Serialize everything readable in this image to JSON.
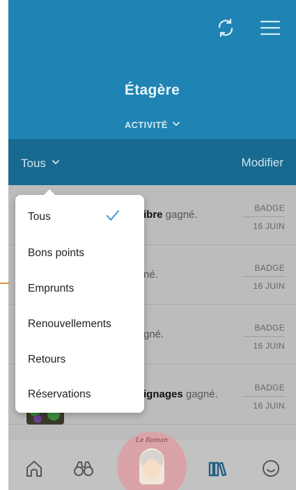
{
  "header": {
    "title": "Étagère",
    "subtitle": "ACTIVITÉ",
    "refresh_icon": "refresh-icon",
    "menu_icon": "hamburger-menu-icon"
  },
  "filterbar": {
    "selected": "Tous",
    "edit_label": "Modifier"
  },
  "dropdown": {
    "items": [
      "Tous",
      "Bons points",
      "Emprunts",
      "Renouvellements",
      "Retours",
      "Réservations"
    ],
    "selected_index": 0
  },
  "activity": [
    {
      "bold": "ibre",
      "rest": " gagné.",
      "badge": "BADGE",
      "date": "16 JUIN"
    },
    {
      "bold": "",
      "rest": "né.",
      "badge": "BADGE",
      "date": "16 JUIN"
    },
    {
      "bold": "",
      "rest": "gné.",
      "badge": "BADGE",
      "date": "16 JUIN"
    },
    {
      "bold": "ignages",
      "rest": " gagné.",
      "badge": "BADGE",
      "date": "16 JUIN"
    }
  ],
  "bottomnav": {
    "items": [
      "home-icon",
      "binoculars-icon",
      "featured-book-cover",
      "shelf-icon",
      "smiley-icon"
    ],
    "cover_title": "Le Roman"
  },
  "colors": {
    "header": "#1f83b3",
    "filterbar": "#17698f",
    "accent": "#3a9dd0"
  }
}
